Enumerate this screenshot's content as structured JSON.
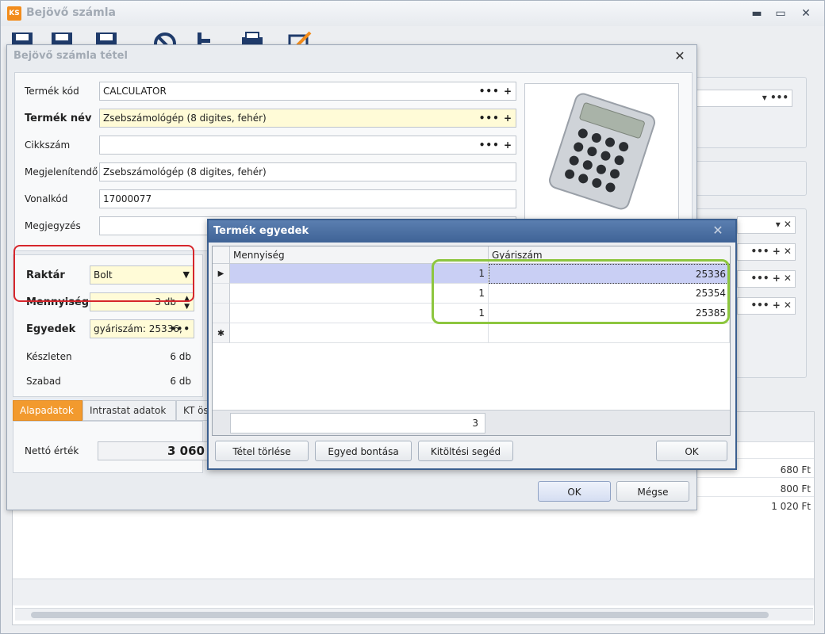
{
  "main_window": {
    "title": "Bejövő számla",
    "logo": "KS",
    "controls": {
      "minimize": "▬",
      "maximize": "▭",
      "close": "✕"
    },
    "toolbar_icons": [
      "save-icon",
      "save-new-icon",
      "save-close-icon",
      "cancel-icon",
      "hierarchy-icon",
      "print-icon",
      "edit-icon"
    ]
  },
  "background": {
    "combo_dropdown": "▾ •••",
    "row_buttons": "•••  +  ✕",
    "prices": [
      "680 Ft",
      "800 Ft",
      "1 020 Ft"
    ]
  },
  "tetel_dialog": {
    "title": "Bejövő számla tétel",
    "close": "✕",
    "fields": {
      "termek_kod": {
        "label": "Termék kód",
        "value": "CALCULATOR"
      },
      "termek_nev": {
        "label": "Termék név",
        "value": "Zsebszámológép (8 digites, fehér)"
      },
      "cikkszam": {
        "label": "Cikkszám",
        "value": ""
      },
      "megjelenitendo": {
        "label": "Megjelenítendő",
        "value": "Zsebszámológép (8 digites, fehér)"
      },
      "vonalkod": {
        "label": "Vonalkód",
        "value": "17000077"
      },
      "megjegyzes": {
        "label": "Megjegyzés",
        "value": ""
      }
    },
    "field_buttons": "•••  +",
    "stock": {
      "raktar": {
        "label": "Raktár",
        "value": "Bolt"
      },
      "mennyiseg": {
        "label": "Mennyiség",
        "value": "3 db"
      },
      "egyedek": {
        "label": "Egyedek",
        "value": "gyáriszám: 25336,"
      },
      "keszleten": {
        "label": "Készleten",
        "value": "6 db"
      },
      "szabad": {
        "label": "Szabad",
        "value": "6 db"
      }
    },
    "tabs": [
      "Alapadatok",
      "Intrastat adatok",
      "KT ös"
    ],
    "netto": {
      "label": "Nettó érték",
      "value": "3 060"
    },
    "buttons": {
      "ok": "OK",
      "cancel": "Mégse"
    }
  },
  "egyedek_dialog": {
    "title": "Termék egyedek",
    "close": "✕",
    "columns": [
      "Mennyiség",
      "Gyáriszám"
    ],
    "rows": [
      {
        "mennyiseg": "1",
        "gyariszam": "25336"
      },
      {
        "mennyiseg": "1",
        "gyariszam": "25354"
      },
      {
        "mennyiseg": "1",
        "gyariszam": "25385"
      }
    ],
    "total": "3",
    "buttons": {
      "delete": "Tétel törlése",
      "split": "Egyed bontása",
      "helper": "Kitöltési segéd",
      "ok": "OK"
    }
  }
}
